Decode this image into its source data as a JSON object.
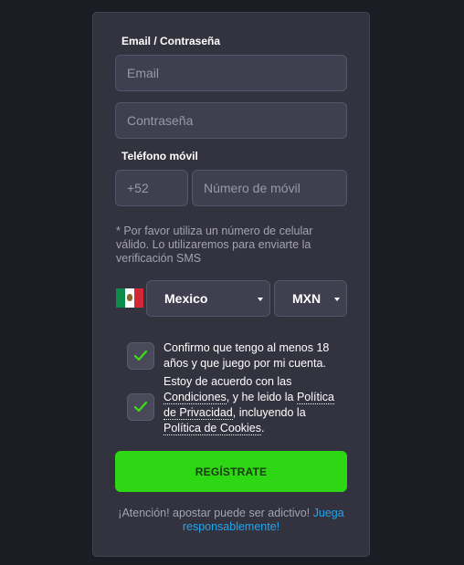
{
  "form": {
    "email_section_label": "Email / Contraseña",
    "email_placeholder": "Email",
    "password_placeholder": "Contraseña",
    "phone_section_label": "Teléfono móvil",
    "phone_code": "+52",
    "phone_placeholder": "Número de móvil",
    "sms_note": "* Por favor utiliza un número de celular válido. Lo utilizaremos para enviarte la verificación SMS",
    "country_value": "Mexico",
    "currency_value": "MXN",
    "age_confirm_text": "Confirmo que tengo al menos 18 años y que juego por mi cuenta.",
    "terms": {
      "prefix": "Estoy de acuerdo con las ",
      "conditions_link": "Condiciones",
      "middle": ", y he leido la ",
      "privacy_link": "Política de Privacidad",
      "middle2": ", incluyendo la ",
      "cookies_link": "Política de Cookies",
      "suffix": "."
    },
    "register_label": "REGÍSTRATE",
    "warning_text": "¡Atención! apostar puede ser adictivo! ",
    "warning_link": "Juega responsablemente!"
  },
  "colors": {
    "background": "#1c1c24",
    "card": "#33323f",
    "field": "#403f50",
    "accent_green": "#2dd714",
    "link_blue": "#1fa7f0",
    "check_green": "#37e01a"
  },
  "icons": {
    "checkbox_checked": "check-icon",
    "flag": "mexico-flag-icon",
    "dropdown": "caret-down-icon"
  }
}
